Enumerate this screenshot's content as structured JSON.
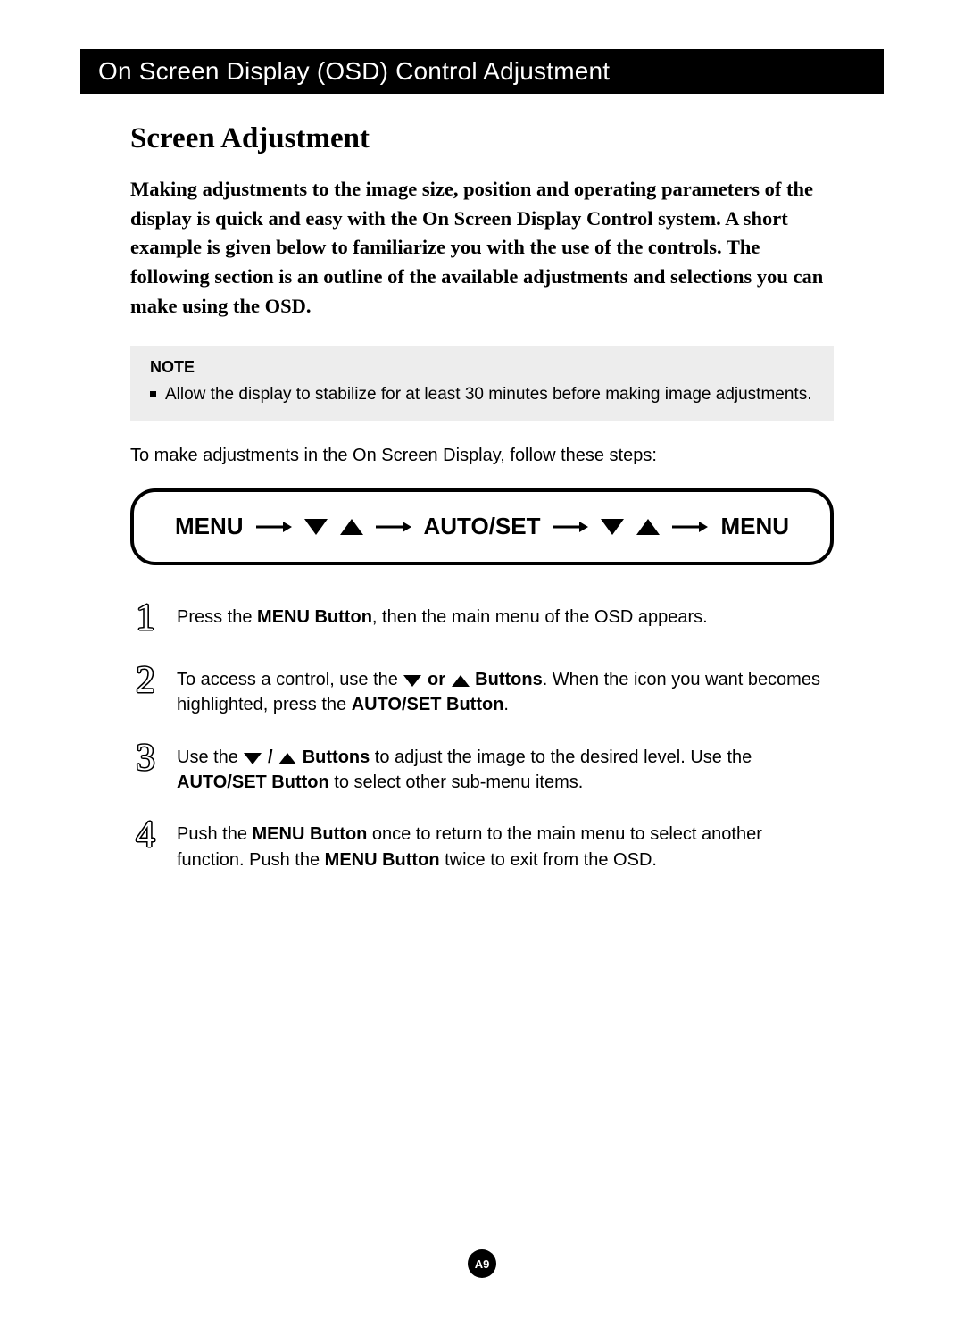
{
  "title_bar": "On Screen Display (OSD) Control Adjustment",
  "heading": "Screen Adjustment",
  "intro": "Making adjustments to the image size, position and operating parameters of the display is quick and easy with the On Screen Display Control system. A short example is given below to familiarize you with the use of the controls. The following section is an outline of the available adjustments and selections you can make using the OSD.",
  "note": {
    "label": "NOTE",
    "text": "Allow the display to stabilize for at least 30 minutes before making image adjustments."
  },
  "lead_in": "To make adjustments in the On Screen Display, follow these steps:",
  "flow": {
    "menu": "MENU",
    "auto_set": "AUTO/SET",
    "menu_end": "MENU"
  },
  "steps": {
    "s1": {
      "num": "1",
      "a": "Press the ",
      "b": "MENU Button",
      "c": ", then the main menu of the OSD appears."
    },
    "s2": {
      "num": "2",
      "a": "To access a control, use the ",
      "or": " or ",
      "b": " Buttons",
      "c": ". When the icon you want becomes highlighted, press the ",
      "d": "AUTO/SET Button",
      "e": "."
    },
    "s3": {
      "num": "3",
      "a": " Use the  ",
      "slash": " / ",
      "b": "  Buttons",
      "c": " to adjust the image to the desired level. Use the ",
      "d": "AUTO/SET Button",
      "e": " to select other sub-menu items."
    },
    "s4": {
      "num": "4",
      "a": "Push the ",
      "b": "MENU Button",
      "c": " once to return to the main menu to select another function. Push the ",
      "d": "MENU Button",
      "e": " twice to exit from the OSD."
    }
  },
  "page_number": "A9"
}
